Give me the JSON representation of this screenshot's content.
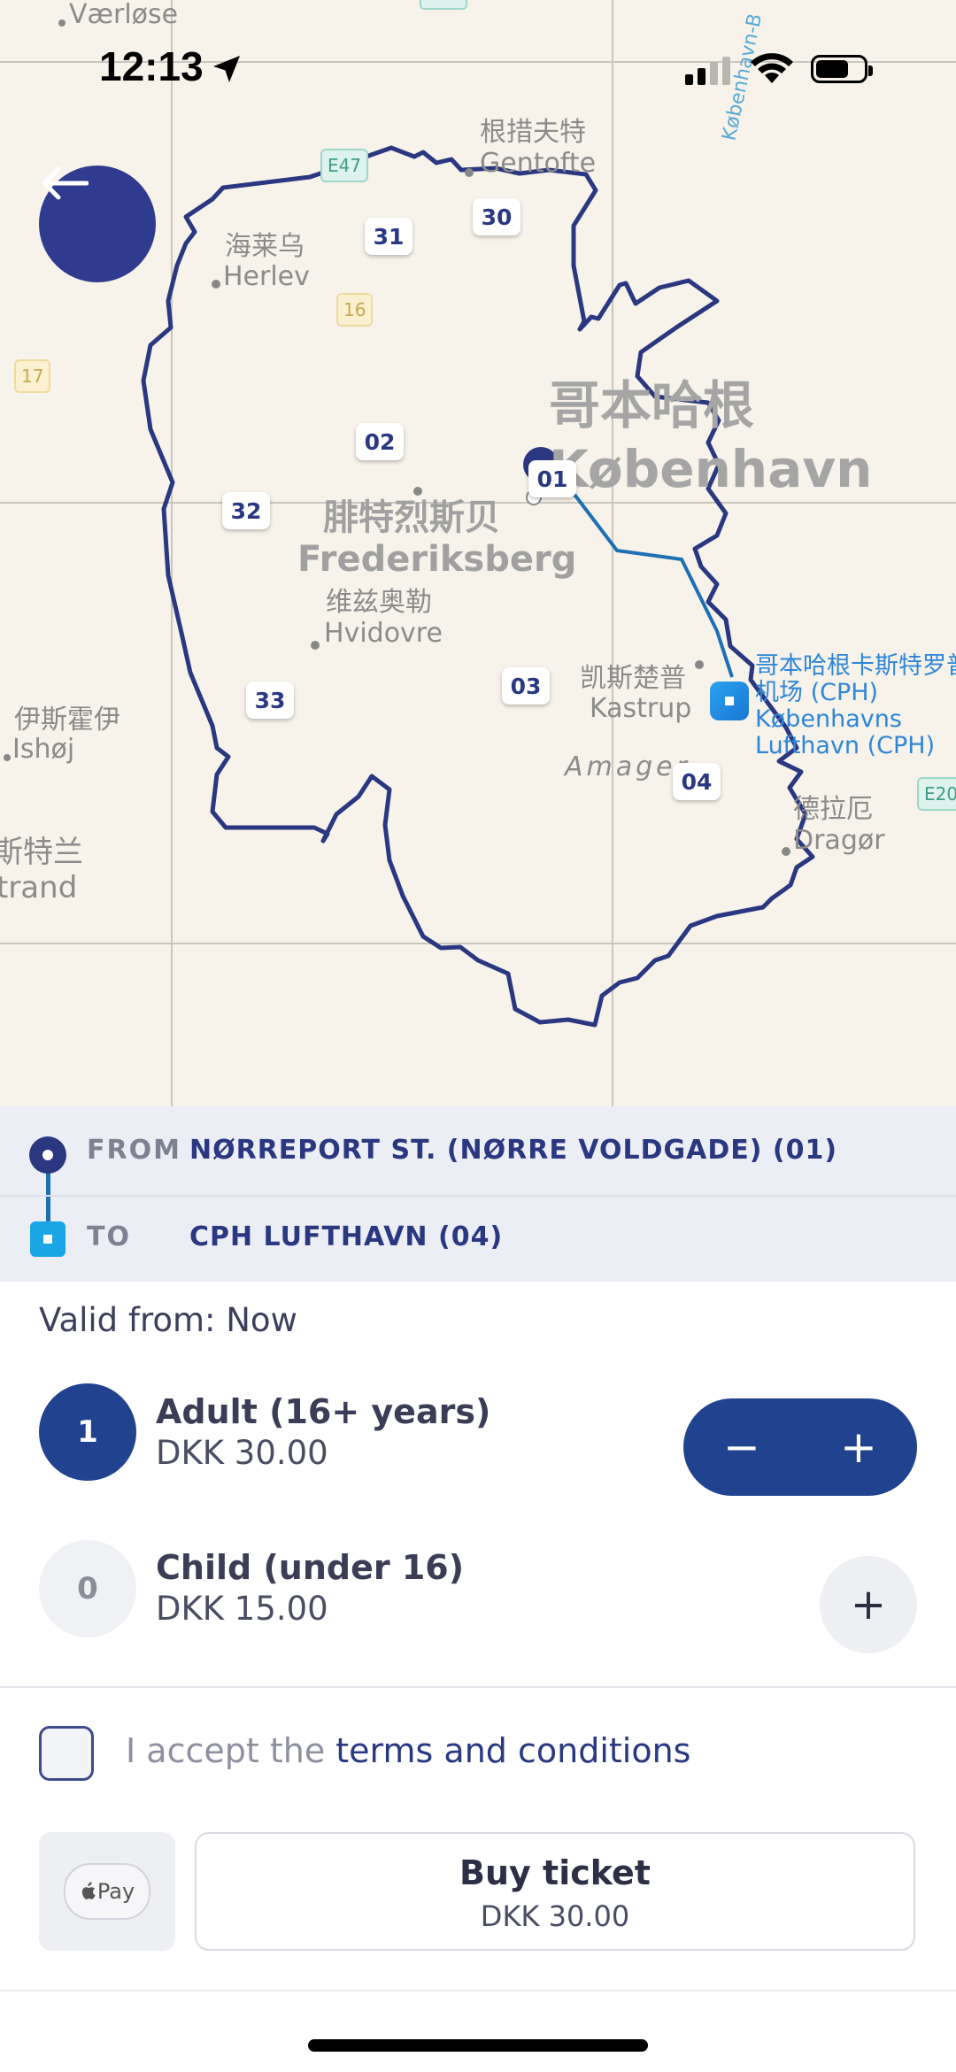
{
  "status_bar": {
    "time": "12:13",
    "icons": [
      "location-arrow-icon",
      "cellular-signal-icon",
      "wifi-icon",
      "battery-icon"
    ]
  },
  "map": {
    "places": {
      "vaerlose": "Værløse",
      "gentofte_zh": "根措夫特",
      "gentofte": "Gentofte",
      "herlev_zh": "海莱乌",
      "herlev": "Herlev",
      "copenhagen_zh": "哥本哈根",
      "copenhagen": "København",
      "frederiksberg_zh": "腓特烈斯贝",
      "frederiksberg": "Frederiksberg",
      "hvidovre_zh": "维兹奥勒",
      "hvidovre": "Hvidovre",
      "kastrup_zh": "凯斯楚普",
      "kastrup": "Kastrup",
      "amager": "Amager",
      "ishoj_zh": "伊斯霍伊",
      "ishoj": "Ishøj",
      "strand_zh": "斯特兰",
      "strand": "trand",
      "dragor_zh": "德拉厄",
      "dragor": "Dragør",
      "airport_zh_1": "哥本哈根卡斯特罗普",
      "airport_zh_2": "机场 (CPH)",
      "airport_1": "Københavns",
      "airport_2": "Lufthavn (CPH)",
      "road_text": "København-B"
    },
    "roads": {
      "e47": "E47",
      "e20": "E20",
      "r16": "16",
      "r17": "17"
    },
    "zones": {
      "z01": "01",
      "z02": "02",
      "z03": "03",
      "z04": "04",
      "z30": "30",
      "z31": "31",
      "z32": "32",
      "z33": "33"
    },
    "colors": {
      "zone_border": "#2a3781",
      "route_line": "#1f6fb5",
      "background": "#f7f3ea"
    }
  },
  "route": {
    "from_label": "FROM",
    "from_value": "NØRREPORT ST. (NØRRE VOLDGADE) (01)",
    "to_label": "TO",
    "to_value": "CPH LUFTHAVN (04)"
  },
  "ticket": {
    "valid_from": "Valid from: Now",
    "passengers": [
      {
        "count": "1",
        "type": "Adult (16+ years)",
        "price": "DKK 30.00"
      },
      {
        "count": "0",
        "type": "Child (under 16)",
        "price": "DKK 15.00"
      }
    ],
    "stepper_minus": "−",
    "stepper_plus": "+",
    "child_plus": "+"
  },
  "terms": {
    "prefix": "I accept the ",
    "link": "terms and conditions"
  },
  "purchase": {
    "apple_pay_label": "Pay",
    "buy_label": "Buy ticket",
    "buy_price": "DKK 30.00"
  },
  "theme": {
    "primary": "#2a3781",
    "accent_blue": "#1aa6e6"
  }
}
